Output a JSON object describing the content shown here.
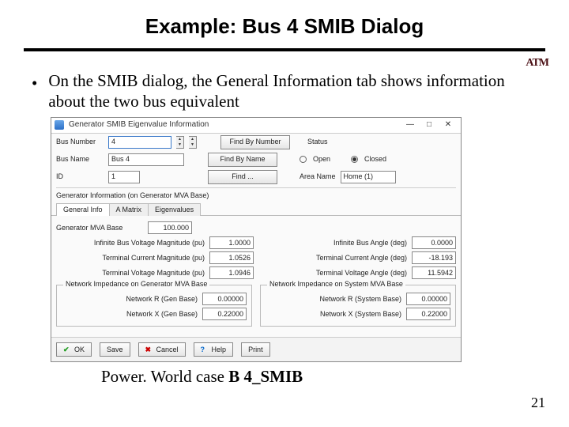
{
  "slide": {
    "title": "Example: Bus 4 SMIB Dialog",
    "bullet": "On the SMIB dialog, the General Information tab shows information about the two bus equivalent",
    "caption_prefix": "Power. World case ",
    "caption_bold": "B 4_SMIB",
    "page_number": "21",
    "logo": "ATM"
  },
  "dialog": {
    "title": "Generator SMIB Eigenvalue Information",
    "win": {
      "min": "—",
      "max": "□",
      "close": "✕"
    },
    "top": {
      "bus_number_label": "Bus Number",
      "bus_number_value": "4",
      "bus_name_label": "Bus Name",
      "bus_name_value": "Bus 4",
      "id_label": "ID",
      "id_value": "1",
      "find_by_number": "Find By Number",
      "find_by_name": "Find By Name",
      "find": "Find ...",
      "status_label": "Status",
      "open_label": "Open",
      "closed_label": "Closed",
      "area_name_label": "Area Name",
      "area_name_value": "Home (1)"
    },
    "section_label": "Generator Information (on Generator MVA Base)",
    "tabs": {
      "general": "General Info",
      "amatrix": "A Matrix",
      "eigen": "Eigenvalues"
    },
    "fields": {
      "gen_mva_base_label": "Generator MVA Base",
      "gen_mva_base": "100.000",
      "inf_vmag_label": "Infinite Bus Voltage Magnitude (pu)",
      "inf_vmag": "1.0000",
      "inf_vang_label": "Infinite Bus Angle (deg)",
      "inf_vang": "0.0000",
      "term_imag_label": "Terminal Current Magnitude (pu)",
      "term_imag": "1.0526",
      "term_iang_label": "Terminal Current Angle (deg)",
      "term_iang": "-18.193",
      "term_vmag_label": "Terminal Voltage Magnitude (pu)",
      "term_vmag": "1.0946",
      "term_vang_label": "Terminal Voltage Angle (deg)",
      "term_vang": "11.5942"
    },
    "group": {
      "left_legend": "Network Impedance on Generator MVA Base",
      "right_legend": "Network Impedance on System MVA Base",
      "r_gen_label": "Network R (Gen Base)",
      "r_gen": "0.00000",
      "x_gen_label": "Network X (Gen Base)",
      "x_gen": "0.22000",
      "r_sys_label": "Network R (System Base)",
      "r_sys": "0.00000",
      "x_sys_label": "Network X (System Base)",
      "x_sys": "0.22000"
    },
    "footer": {
      "ok": "OK",
      "save": "Save",
      "cancel": "Cancel",
      "help": "Help",
      "print": "Print"
    }
  }
}
